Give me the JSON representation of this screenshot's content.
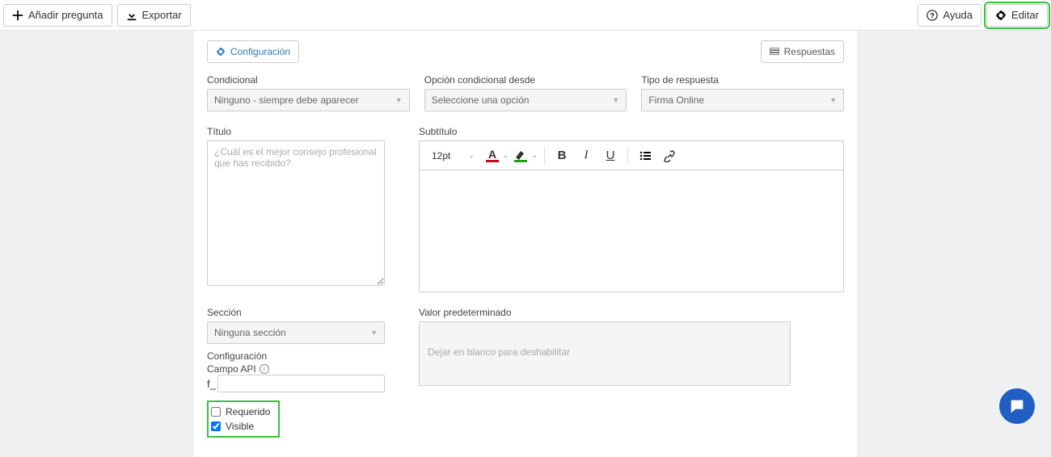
{
  "toolbar": {
    "add_question": "Añadir pregunta",
    "export": "Exportar",
    "help": "Ayuda",
    "edit": "Editar"
  },
  "tabs": {
    "config": "Configuración",
    "responses": "Respuestas"
  },
  "fields": {
    "conditional": {
      "label": "Condicional",
      "value": "Ninguno - siempre debe aparecer"
    },
    "conditional_from": {
      "label": "Opción condicional desde",
      "value": "Seleccione una opción"
    },
    "response_type": {
      "label": "Tipo de respuesta",
      "value": "Firma Online"
    },
    "title": {
      "label": "Título",
      "placeholder": "¿Cuál es el mejor consejo profesional que has recibido?"
    },
    "subtitle": {
      "label": "Subtítulo"
    },
    "section": {
      "label": "Sección",
      "value": "Ninguna sección"
    },
    "config_label": "Configuración",
    "api_field_label": "Campo API",
    "api_prefix": "f_",
    "default_value": {
      "label": "Valor predeterminado",
      "placeholder": "Dejar en blanco para deshabilitar"
    },
    "required": "Requerido",
    "visible": "Visible"
  },
  "editor": {
    "font_size": "12pt",
    "text_glyph": "A",
    "text_bar_color": "#d0021b",
    "highlight_bar_color": "#1aa31a"
  }
}
